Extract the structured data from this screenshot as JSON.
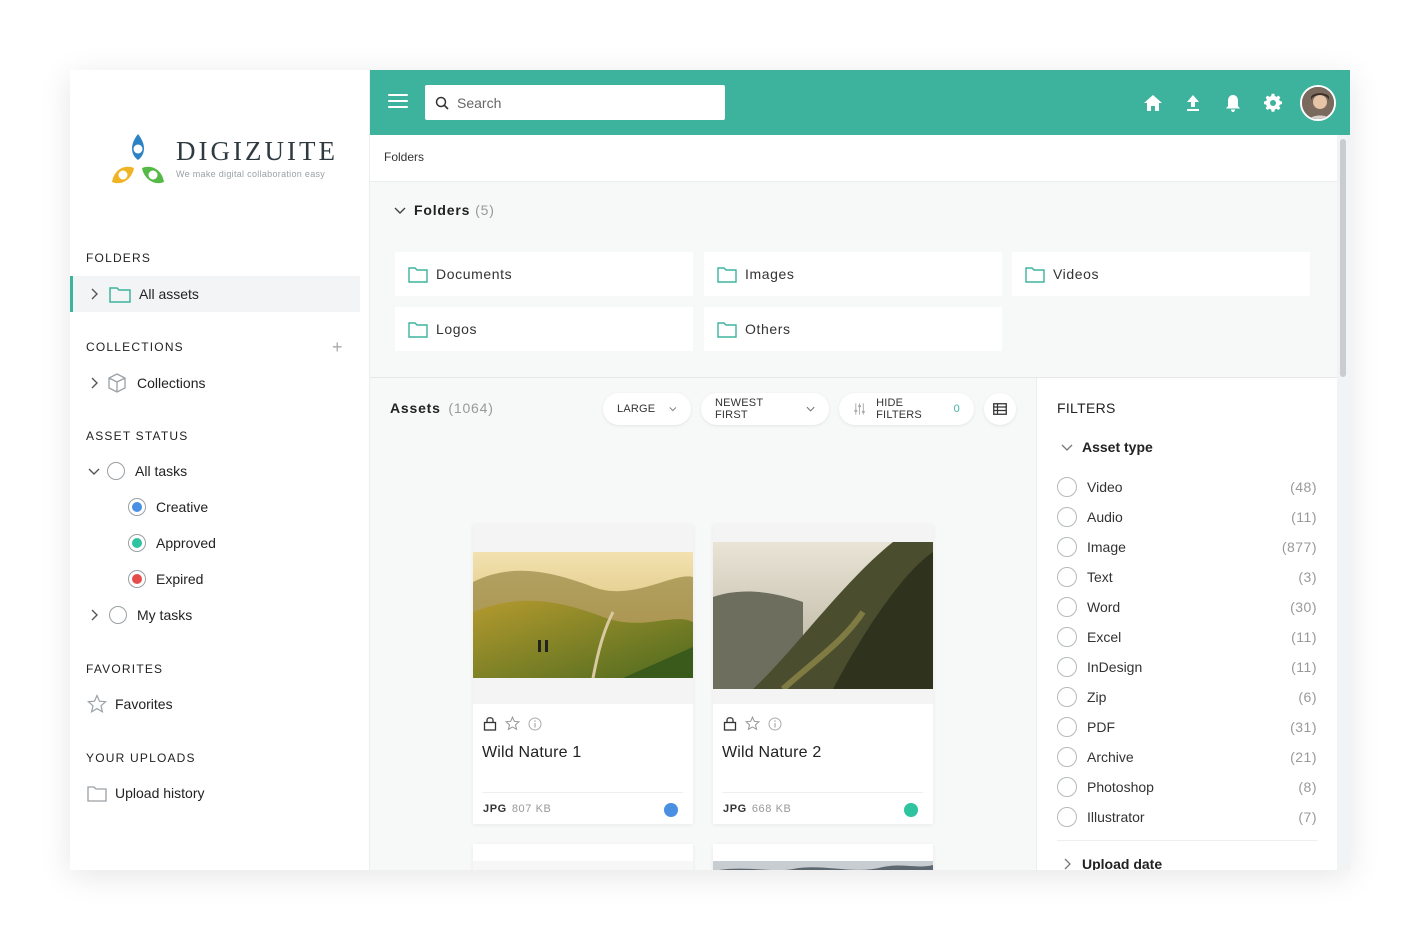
{
  "brand": {
    "name": "DIGIZUITE",
    "tagline": "We make digital collaboration easy"
  },
  "sidebar": {
    "folders": {
      "title": "FOLDERS",
      "items": [
        {
          "label": "All assets"
        }
      ]
    },
    "collections": {
      "title": "COLLECTIONS",
      "add": "+",
      "items": [
        {
          "label": "Collections"
        }
      ]
    },
    "asset_status": {
      "title": "ASSET STATUS",
      "all_tasks": "All tasks",
      "sub": [
        {
          "label": "Creative",
          "color": "#4a90e2"
        },
        {
          "label": "Approved",
          "color": "#2ec4a0"
        },
        {
          "label": "Expired",
          "color": "#e74c4c"
        }
      ],
      "my_tasks": "My tasks"
    },
    "favorites": {
      "title": "FAVORITES",
      "item": "Favorites"
    },
    "uploads": {
      "title": "YOUR UPLOADS",
      "item": "Upload history"
    }
  },
  "topbar": {
    "search_placeholder": "Search",
    "accent": "#3db39e"
  },
  "breadcrumb": "Folders",
  "folders_panel": {
    "title": "Folders",
    "count": "(5)",
    "items": [
      "Documents",
      "Images",
      "Videos",
      "Logos",
      "Others"
    ]
  },
  "assets": {
    "title": "Assets",
    "count": "(1064)",
    "size_option": "LARGE",
    "sort_option": "NEWEST FIRST",
    "filters_toggle": "HIDE FILTERS",
    "filters_count": "0",
    "cards": [
      {
        "title": "Wild Nature 1",
        "format": "JPG",
        "size": "807 KB",
        "status_color": "#4a90e2"
      },
      {
        "title": "Wild Nature 2",
        "format": "JPG",
        "size": "668 KB",
        "status_color": "#2ec4a0"
      }
    ]
  },
  "filters": {
    "title": "FILTERS",
    "group": "Asset type",
    "options": [
      {
        "label": "Video",
        "count": "(48)"
      },
      {
        "label": "Audio",
        "count": "(11)"
      },
      {
        "label": "Image",
        "count": "(877)"
      },
      {
        "label": "Text",
        "count": "(3)"
      },
      {
        "label": "Word",
        "count": "(30)"
      },
      {
        "label": "Excel",
        "count": "(11)"
      },
      {
        "label": "InDesign",
        "count": "(11)"
      },
      {
        "label": "Zip",
        "count": "(6)"
      },
      {
        "label": "PDF",
        "count": "(31)"
      },
      {
        "label": "Archive",
        "count": "(21)"
      },
      {
        "label": "Photoshop",
        "count": "(8)"
      },
      {
        "label": "Illustrator",
        "count": "(7)"
      }
    ],
    "group2": "Upload date"
  }
}
